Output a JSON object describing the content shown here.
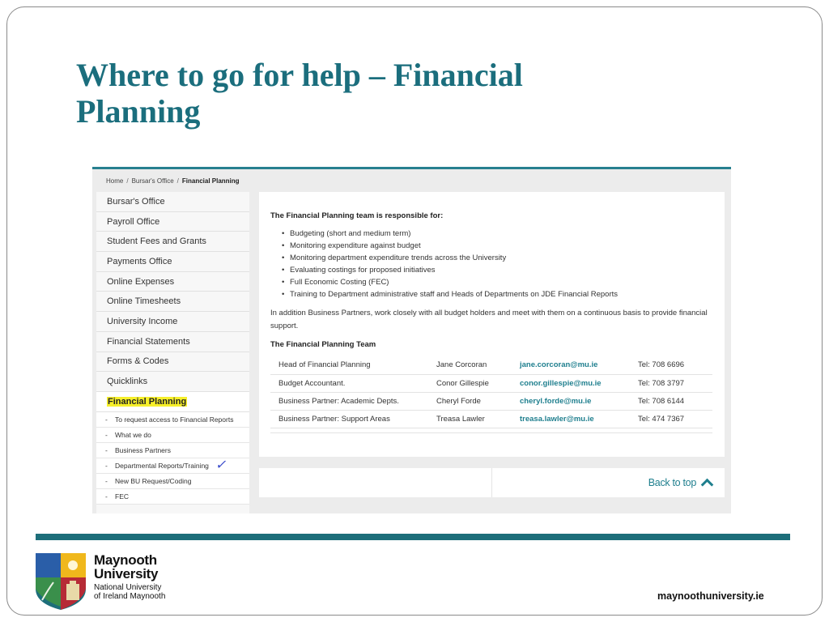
{
  "slide": {
    "title": "Where to go for help – Financial Planning",
    "site_url": "maynoothuniversity.ie"
  },
  "breadcrumb": {
    "items": [
      "Home",
      "Bursar's Office",
      "Financial Planning"
    ],
    "separator": "/"
  },
  "sidebar": {
    "items": [
      "Bursar's Office",
      "Payroll Office",
      "Student Fees and Grants",
      "Payments Office",
      "Online Expenses",
      "Online Timesheets",
      "University Income",
      "Financial Statements",
      "Forms & Codes",
      "Quicklinks"
    ],
    "active_item": "Financial Planning",
    "subitems": [
      "To request access to Financial Reports",
      "What we do",
      "Business Partners",
      "Departmental Reports/Training",
      "New BU Request/Coding",
      "FEC"
    ],
    "subitem_marker": "-",
    "checkmark": "✓"
  },
  "content": {
    "responsibilities_heading": "The Financial Planning team is responsible for:",
    "responsibilities": [
      "Budgeting (short and medium term)",
      "Monitoring expenditure against budget",
      "Monitoring department expenditure trends across the University",
      "Evaluating costings for proposed initiatives",
      "Full Economic Costing (FEC)",
      "Training to Department administrative staff and Heads of Departments on JDE Financial Reports"
    ],
    "paragraph": "In addition Business Partners, work closely with all budget holders and meet with them on a continuous basis to provide financial support.",
    "team_heading": "The Financial Planning Team",
    "team": [
      {
        "role": "Head of Financial Planning",
        "name": "Jane Corcoran",
        "email": "jane.corcoran@mu.ie",
        "tel": "Tel: 708 6696"
      },
      {
        "role": "Budget Accountant.",
        "name": "Conor Gillespie",
        "email": "conor.gillespie@mu.ie",
        "tel": "Tel: 708 3797"
      },
      {
        "role": "Business Partner: Academic Depts.",
        "name": "Cheryl Forde",
        "email": "cheryl.forde@mu.ie",
        "tel": "Tel: 708 6144"
      },
      {
        "role": "Business Partner: Support Areas",
        "name": "Treasa Lawler",
        "email": "treasa.lawler@mu.ie",
        "tel": "Tel: 474 7367"
      }
    ]
  },
  "footer": {
    "back_to_top": "Back to top"
  },
  "logo": {
    "name_line1": "Maynooth",
    "name_line2": "University",
    "sub_line1": "National University",
    "sub_line2": "of Ireland Maynooth"
  },
  "colors": {
    "brand_teal": "#1d6e7a",
    "link_teal": "#1f7f8e",
    "highlight": "#f6ef2a"
  }
}
